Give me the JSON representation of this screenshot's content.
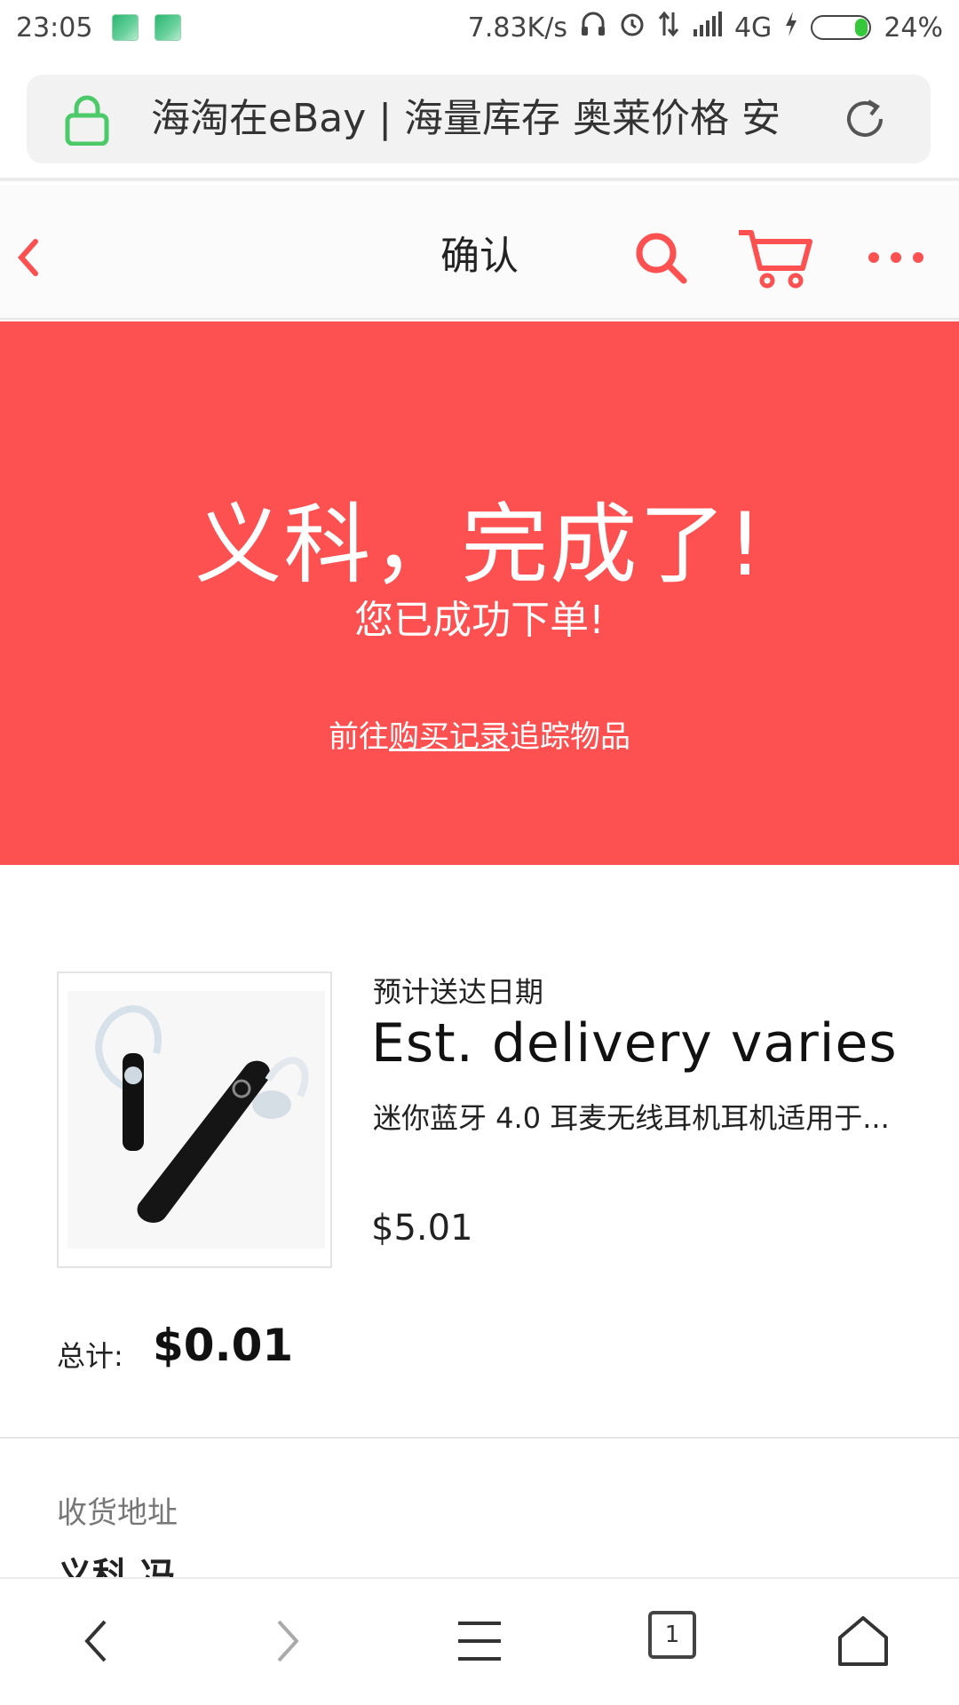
{
  "status_bar": {
    "time": "23:05",
    "net_speed": "7.83K/s",
    "network": "4G",
    "battery": "24%"
  },
  "browser": {
    "url_title": "海淘在eBay | 海量库存 奥莱价格 安"
  },
  "header": {
    "title": "确认"
  },
  "hero": {
    "heading": "义科，完成了!",
    "subheading": "您已成功下单!",
    "link_prefix": "前往",
    "link_text": "购买记录",
    "link_suffix": "追踪物品"
  },
  "order": {
    "delivery_label": "预计送达日期",
    "delivery_value": "Est. delivery varies",
    "item_title": "迷你蓝牙 4.0 耳麦无线耳机耳机适用于...",
    "item_price": "$5.01",
    "total_label": "总计:",
    "total_value": "$0.01"
  },
  "shipping": {
    "label": "收货地址",
    "name": "义科 冯"
  },
  "bottom_nav": {
    "tab_count": "1"
  },
  "colors": {
    "accent": "#fd5051",
    "text": "#111111"
  },
  "icons": [
    "lock-icon",
    "reload-icon",
    "back-chevron-icon",
    "search-icon",
    "cart-icon",
    "more-icon",
    "back-icon",
    "forward-icon",
    "menu-icon",
    "tabs-icon",
    "home-icon"
  ]
}
